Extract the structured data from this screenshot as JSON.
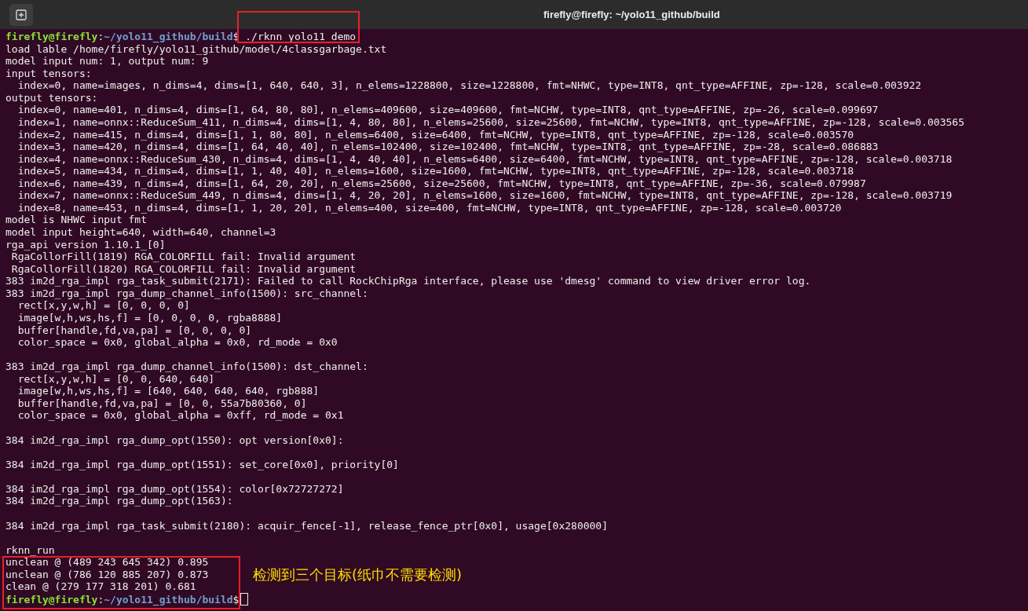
{
  "window": {
    "title": "firefly@firefly: ~/yolo11_github/build"
  },
  "terminal": {
    "lines": [
      {
        "kind": "prompt",
        "user": "firefly@firefly",
        "separator": ":",
        "path": "~/yolo11_github/build",
        "symbol": "$",
        "command": " ./rknn_yolo11_demo",
        "command_boxed": true,
        "cursor": false
      },
      {
        "kind": "output",
        "text": "load lable /home/firefly/yolo11_github/model/4classgarbage.txt"
      },
      {
        "kind": "output",
        "text": "model input num: 1, output num: 9"
      },
      {
        "kind": "output",
        "text": "input tensors:"
      },
      {
        "kind": "output",
        "text": "  index=0, name=images, n_dims=4, dims=[1, 640, 640, 3], n_elems=1228800, size=1228800, fmt=NHWC, type=INT8, qnt_type=AFFINE, zp=-128, scale=0.003922"
      },
      {
        "kind": "output",
        "text": "output tensors:"
      },
      {
        "kind": "output",
        "text": "  index=0, name=401, n_dims=4, dims=[1, 64, 80, 80], n_elems=409600, size=409600, fmt=NCHW, type=INT8, qnt_type=AFFINE, zp=-26, scale=0.099697"
      },
      {
        "kind": "output",
        "text": "  index=1, name=onnx::ReduceSum_411, n_dims=4, dims=[1, 4, 80, 80], n_elems=25600, size=25600, fmt=NCHW, type=INT8, qnt_type=AFFINE, zp=-128, scale=0.003565"
      },
      {
        "kind": "output",
        "text": "  index=2, name=415, n_dims=4, dims=[1, 1, 80, 80], n_elems=6400, size=6400, fmt=NCHW, type=INT8, qnt_type=AFFINE, zp=-128, scale=0.003570"
      },
      {
        "kind": "output",
        "text": "  index=3, name=420, n_dims=4, dims=[1, 64, 40, 40], n_elems=102400, size=102400, fmt=NCHW, type=INT8, qnt_type=AFFINE, zp=-28, scale=0.086883"
      },
      {
        "kind": "output",
        "text": "  index=4, name=onnx::ReduceSum_430, n_dims=4, dims=[1, 4, 40, 40], n_elems=6400, size=6400, fmt=NCHW, type=INT8, qnt_type=AFFINE, zp=-128, scale=0.003718"
      },
      {
        "kind": "output",
        "text": "  index=5, name=434, n_dims=4, dims=[1, 1, 40, 40], n_elems=1600, size=1600, fmt=NCHW, type=INT8, qnt_type=AFFINE, zp=-128, scale=0.003718"
      },
      {
        "kind": "output",
        "text": "  index=6, name=439, n_dims=4, dims=[1, 64, 20, 20], n_elems=25600, size=25600, fmt=NCHW, type=INT8, qnt_type=AFFINE, zp=-36, scale=0.079987"
      },
      {
        "kind": "output",
        "text": "  index=7, name=onnx::ReduceSum_449, n_dims=4, dims=[1, 4, 20, 20], n_elems=1600, size=1600, fmt=NCHW, type=INT8, qnt_type=AFFINE, zp=-128, scale=0.003719"
      },
      {
        "kind": "output",
        "text": "  index=8, name=453, n_dims=4, dims=[1, 1, 20, 20], n_elems=400, size=400, fmt=NCHW, type=INT8, qnt_type=AFFINE, zp=-128, scale=0.003720"
      },
      {
        "kind": "output",
        "text": "model is NHWC input fmt"
      },
      {
        "kind": "output",
        "text": "model input height=640, width=640, channel=3"
      },
      {
        "kind": "output",
        "text": "rga_api version 1.10.1_[0]"
      },
      {
        "kind": "output",
        "text": " RgaCollorFill(1819) RGA_COLORFILL fail: Invalid argument"
      },
      {
        "kind": "output",
        "text": " RgaCollorFill(1820) RGA_COLORFILL fail: Invalid argument"
      },
      {
        "kind": "output",
        "text": "383 im2d_rga_impl rga_task_submit(2171): Failed to call RockChipRga interface, please use 'dmesg' command to view driver error log."
      },
      {
        "kind": "output",
        "text": "383 im2d_rga_impl rga_dump_channel_info(1500): src_channel:"
      },
      {
        "kind": "output",
        "text": "  rect[x,y,w,h] = [0, 0, 0, 0]"
      },
      {
        "kind": "output",
        "text": "  image[w,h,ws,hs,f] = [0, 0, 0, 0, rgba8888]"
      },
      {
        "kind": "output",
        "text": "  buffer[handle,fd,va,pa] = [0, 0, 0, 0]"
      },
      {
        "kind": "output",
        "text": "  color_space = 0x0, global_alpha = 0x0, rd_mode = 0x0"
      },
      {
        "kind": "blank"
      },
      {
        "kind": "output",
        "text": "383 im2d_rga_impl rga_dump_channel_info(1500): dst_channel:"
      },
      {
        "kind": "output",
        "text": "  rect[x,y,w,h] = [0, 0, 640, 640]"
      },
      {
        "kind": "output",
        "text": "  image[w,h,ws,hs,f] = [640, 640, 640, 640, rgb888]"
      },
      {
        "kind": "output",
        "text": "  buffer[handle,fd,va,pa] = [0, 0, 55a7b80360, 0]"
      },
      {
        "kind": "output",
        "text": "  color_space = 0x0, global_alpha = 0xff, rd_mode = 0x1"
      },
      {
        "kind": "blank"
      },
      {
        "kind": "output",
        "text": "384 im2d_rga_impl rga_dump_opt(1550): opt version[0x0]:"
      },
      {
        "kind": "blank"
      },
      {
        "kind": "output",
        "text": "384 im2d_rga_impl rga_dump_opt(1551): set_core[0x0], priority[0]"
      },
      {
        "kind": "blank"
      },
      {
        "kind": "output",
        "text": "384 im2d_rga_impl rga_dump_opt(1554): color[0x72727272]"
      },
      {
        "kind": "output",
        "text": "384 im2d_rga_impl rga_dump_opt(1563):"
      },
      {
        "kind": "blank"
      },
      {
        "kind": "output",
        "text": "384 im2d_rga_impl rga_task_submit(2180): acquir_fence[-1], release_fence_ptr[0x0], usage[0x280000]"
      },
      {
        "kind": "blank"
      },
      {
        "kind": "output",
        "text": "rknn_run"
      },
      {
        "kind": "annotated_group",
        "note": "检测到三个目标(纸巾不需要检测)",
        "lines": [
          {
            "kind": "output",
            "text": "unclean @ (489 243 645 342) 0.895"
          },
          {
            "kind": "output",
            "text": "unclean @ (786 120 885 207) 0.873"
          },
          {
            "kind": "output",
            "text": "clean @ (279 177 318 201) 0.681"
          },
          {
            "kind": "prompt",
            "user": "firefly@firefly",
            "separator": ":",
            "path": "~/yolo11_github/build",
            "symbol": "$",
            "command_boxed": false,
            "cursor": true
          }
        ]
      }
    ]
  }
}
